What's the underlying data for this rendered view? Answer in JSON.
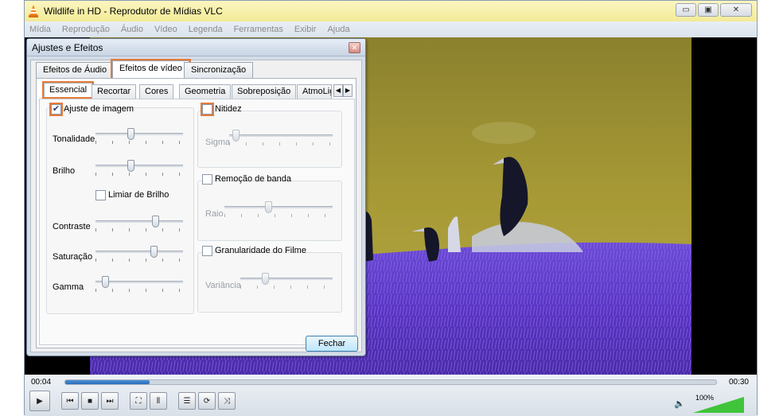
{
  "window": {
    "title": "Wildlife in HD - Reprodutor de Mídias VLC",
    "controls": {
      "minimize": "▭",
      "restore": "▣",
      "close": "✕"
    }
  },
  "menu": [
    "Mídia",
    "Reprodução",
    "Áudio",
    "Vídeo",
    "Legenda",
    "Ferramentas",
    "Exibir",
    "Ajuda"
  ],
  "playback": {
    "elapsed": "00:04",
    "total": "00:30",
    "progress": 0.13
  },
  "volume": {
    "label": "100%",
    "level": 1.0
  },
  "icons": {
    "play": "▶",
    "prev": "⏮",
    "stop": "■",
    "next": "⏭",
    "fullscreen": "⛶",
    "extended": "⦀",
    "playlist": "☰",
    "loop": "⟳",
    "random": "⤨",
    "speaker": "🔈"
  },
  "dialog": {
    "title": "Ajustes e Efeitos",
    "close_label": "✕",
    "tabs": [
      "Efeitos de Áudio",
      "Efeitos de vídeo",
      "Sincronização"
    ],
    "subtabs": [
      "Essencial",
      "Recortar",
      "Cores",
      "Geometria",
      "Sobreposição",
      "AtmoLig"
    ],
    "essential": {
      "image_adjust_label": "Ajuste de imagem",
      "image_adjust_checked": true,
      "hue_label": "Tonalidade",
      "hue_value": 0.4,
      "brightness_label": "Brilho",
      "brightness_value": 0.4,
      "brightness_threshold_label": "Limiar de Brilho",
      "contrast_label": "Contraste",
      "contrast_value": 0.7,
      "saturation_label": "Saturação",
      "saturation_value": 0.68,
      "gamma_label": "Gamma",
      "gamma_value": 0.08,
      "sharpen_label": "Nitidez",
      "sigma_label": "Sigma",
      "sigma_value": 0.03,
      "banding_label": "Remoção de banda",
      "radius_label": "Raio",
      "radius_value": 0.4,
      "grain_label": "Granularidade do Filme",
      "variance_label": "Variância",
      "variance_value": 0.25
    },
    "close_button": "Fechar"
  },
  "colors": {
    "highlight": "#e57b3a",
    "accent": "#2a6cb8"
  }
}
